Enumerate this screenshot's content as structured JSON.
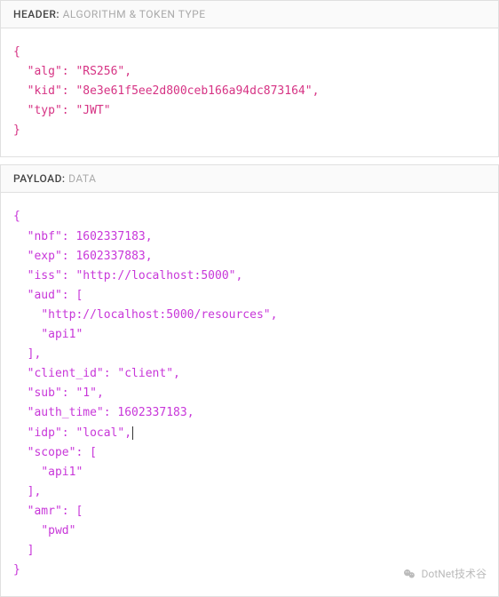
{
  "sections": {
    "header": {
      "label": "HEADER:",
      "subtitle": "ALGORITHM & TOKEN TYPE",
      "data": {
        "alg": "RS256",
        "kid": "8e3e61f5ee2d800ceb166a94dc873164",
        "typ": "JWT"
      }
    },
    "payload": {
      "label": "PAYLOAD:",
      "subtitle": "DATA",
      "data": {
        "nbf": 1602337183,
        "exp": 1602337883,
        "iss": "http://localhost:5000",
        "aud": [
          "http://localhost:5000/resources",
          "api1"
        ],
        "client_id": "client",
        "sub": "1",
        "auth_time": 1602337183,
        "idp": "local",
        "scope": [
          "api1"
        ],
        "amr": [
          "pwd"
        ]
      }
    }
  },
  "watermark": {
    "text": "DotNet技术谷"
  }
}
